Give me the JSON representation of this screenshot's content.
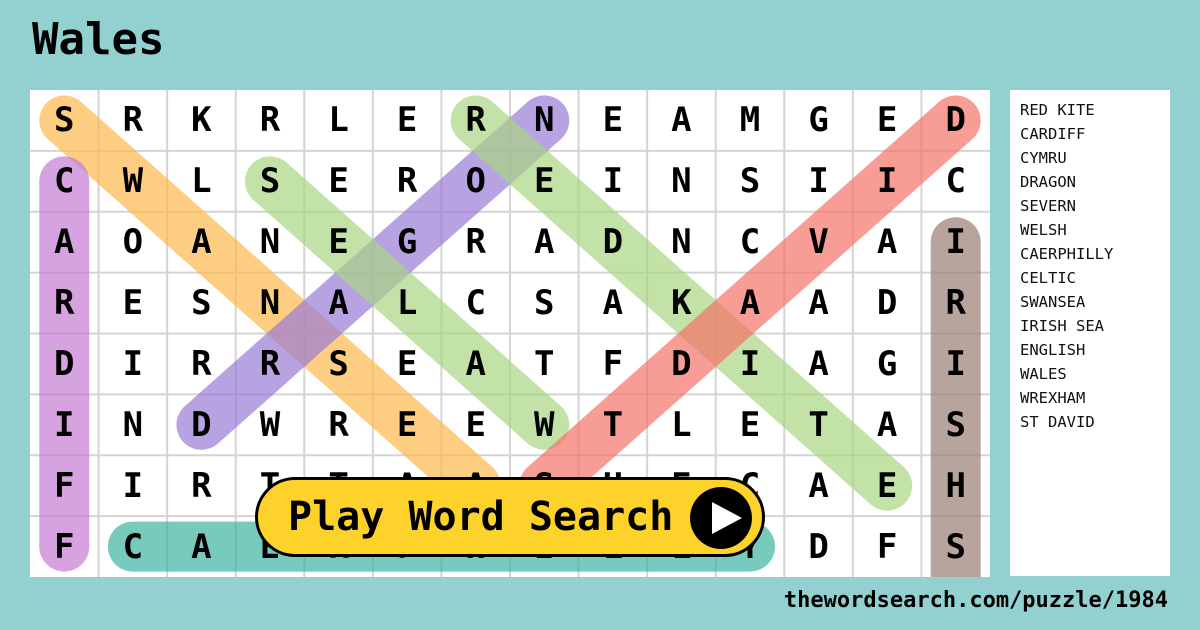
{
  "title": "Wales",
  "grid": [
    "SRKRLERNEAMGED",
    "CWLSEROEINSIIC",
    "AOANEGRADNCVAI",
    "RESNALCSAKAADR",
    "DIRRSEATFDIAGI",
    "INDWREEWTLETAS",
    "FIRTTAASHECAEH",
    "FCAERPHILLYDFS"
  ],
  "highlights": [
    {
      "word": "SWANSEA",
      "from": [
        0,
        0
      ],
      "to": [
        6,
        6
      ],
      "color": "#fdb94e"
    },
    {
      "word": "CARDIFF",
      "from": [
        1,
        0
      ],
      "to": [
        7,
        0
      ],
      "color": "#c57cd3"
    },
    {
      "word": "DRAGON",
      "from": [
        5,
        2
      ],
      "to": [
        0,
        7
      ],
      "color": "#9a7bd6"
    },
    {
      "word": "WALES",
      "from": [
        1,
        3
      ],
      "to": [
        5,
        7
      ],
      "color": "#a9d684"
    },
    {
      "word": "RED KITE",
      "from": [
        0,
        6
      ],
      "to": [
        6,
        12
      ],
      "color": "#a9d684"
    },
    {
      "word": "ST DAVID",
      "from": [
        0,
        13
      ],
      "to": [
        6,
        7
      ],
      "color": "#f6736a"
    },
    {
      "word": "IRISH SEA",
      "from": [
        2,
        13
      ],
      "to": [
        8,
        13
      ],
      "color": "#9a7f74"
    },
    {
      "word": "CAERPHILLY",
      "from": [
        7,
        1
      ],
      "to": [
        7,
        10
      ],
      "color": "#3fb3a3"
    }
  ],
  "word_list": [
    "RED KITE",
    "CARDIFF",
    "CYMRU",
    "DRAGON",
    "SEVERN",
    "WELSH",
    "CAERPHILLY",
    "CELTIC",
    "SWANSEA",
    "IRISH SEA",
    "ENGLISH",
    "WALES",
    "WREXHAM",
    "ST DAVID"
  ],
  "play_button": {
    "label": "Play Word Search",
    "icon": "play-icon"
  },
  "footer": "thewordsearch.com/puzzle/1984"
}
